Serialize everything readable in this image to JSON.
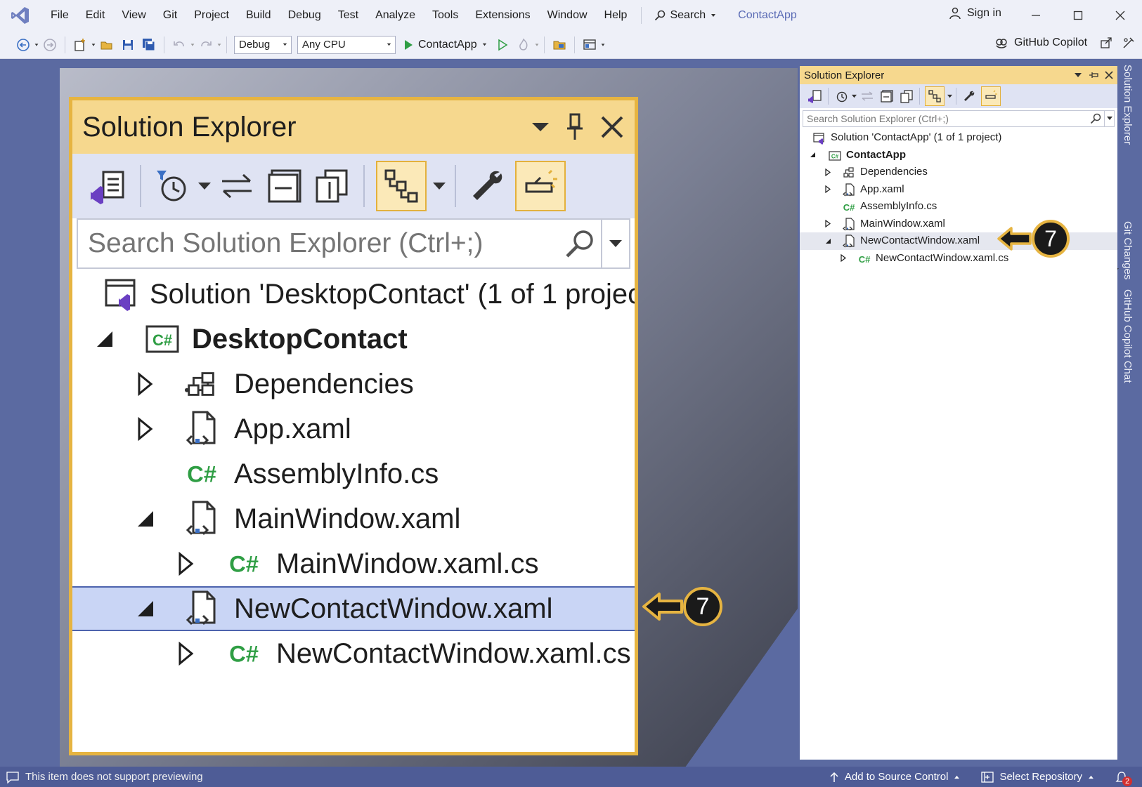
{
  "menubar": {
    "items": [
      "File",
      "Edit",
      "View",
      "Git",
      "Project",
      "Build",
      "Debug",
      "Test",
      "Analyze",
      "Tools",
      "Extensions",
      "Window",
      "Help"
    ],
    "search_label": "Search",
    "app_title": "ContactApp",
    "sign_in": "Sign in"
  },
  "toolbar": {
    "config": "Debug",
    "platform": "Any CPU",
    "run_target": "ContactApp",
    "copilot": "GitHub Copilot"
  },
  "zoom_panel": {
    "title": "Solution Explorer",
    "search_placeholder": "Search Solution Explorer (Ctrl+;)",
    "rows": [
      {
        "label": "Solution 'DesktopContact' (1 of 1 project)",
        "icon": "solution-icon",
        "expander": "none"
      },
      {
        "label": "DesktopContact",
        "icon": "csharp-project-icon",
        "expander": "expanded"
      },
      {
        "label": "Dependencies",
        "icon": "dependencies-icon",
        "expander": "collapsed"
      },
      {
        "label": "App.xaml",
        "icon": "xaml-file-icon",
        "expander": "collapsed"
      },
      {
        "label": "AssemblyInfo.cs",
        "icon": "csharp-file-icon",
        "expander": "none"
      },
      {
        "label": "MainWindow.xaml",
        "icon": "xaml-file-icon",
        "expander": "expanded"
      },
      {
        "label": "MainWindow.xaml.cs",
        "icon": "csharp-file-icon",
        "expander": "collapsed"
      },
      {
        "label": "NewContactWindow.xaml",
        "icon": "xaml-file-icon",
        "expander": "expanded",
        "selected": true
      },
      {
        "label": "NewContactWindow.xaml.cs",
        "icon": "csharp-file-icon",
        "expander": "collapsed"
      }
    ]
  },
  "panel": {
    "title": "Solution Explorer",
    "search_placeholder": "Search Solution Explorer (Ctrl+;)",
    "rows": [
      {
        "label": "Solution 'ContactApp' (1 of 1 project)",
        "icon": "solution-icon",
        "expander": "none"
      },
      {
        "label": "ContactApp",
        "icon": "csharp-project-icon",
        "expander": "expanded"
      },
      {
        "label": "Dependencies",
        "icon": "dependencies-icon",
        "expander": "collapsed"
      },
      {
        "label": "App.xaml",
        "icon": "xaml-file-icon",
        "expander": "collapsed"
      },
      {
        "label": "AssemblyInfo.cs",
        "icon": "csharp-file-icon",
        "expander": "none"
      },
      {
        "label": "MainWindow.xaml",
        "icon": "xaml-file-icon",
        "expander": "collapsed"
      },
      {
        "label": "NewContactWindow.xaml",
        "icon": "xaml-file-icon",
        "expander": "expanded",
        "selected": true
      },
      {
        "label": "NewContactWindow.xaml.cs",
        "icon": "csharp-file-icon",
        "expander": "collapsed"
      }
    ]
  },
  "side_tabs": [
    "Solution Explorer",
    "Git Changes",
    "GitHub Copilot Chat"
  ],
  "callout_number": "7",
  "statusbar": {
    "message": "This item does not support previewing",
    "add_to_source_control": "Add to Source Control",
    "select_repository": "Select Repository",
    "notification_count": "2"
  },
  "colors": {
    "accent_gold": "#e6b441",
    "selection": "#c9d5f5",
    "csharp_green": "#2f9e44",
    "vs_purple": "#6a3fc2",
    "chrome": "#5b6aa1"
  }
}
